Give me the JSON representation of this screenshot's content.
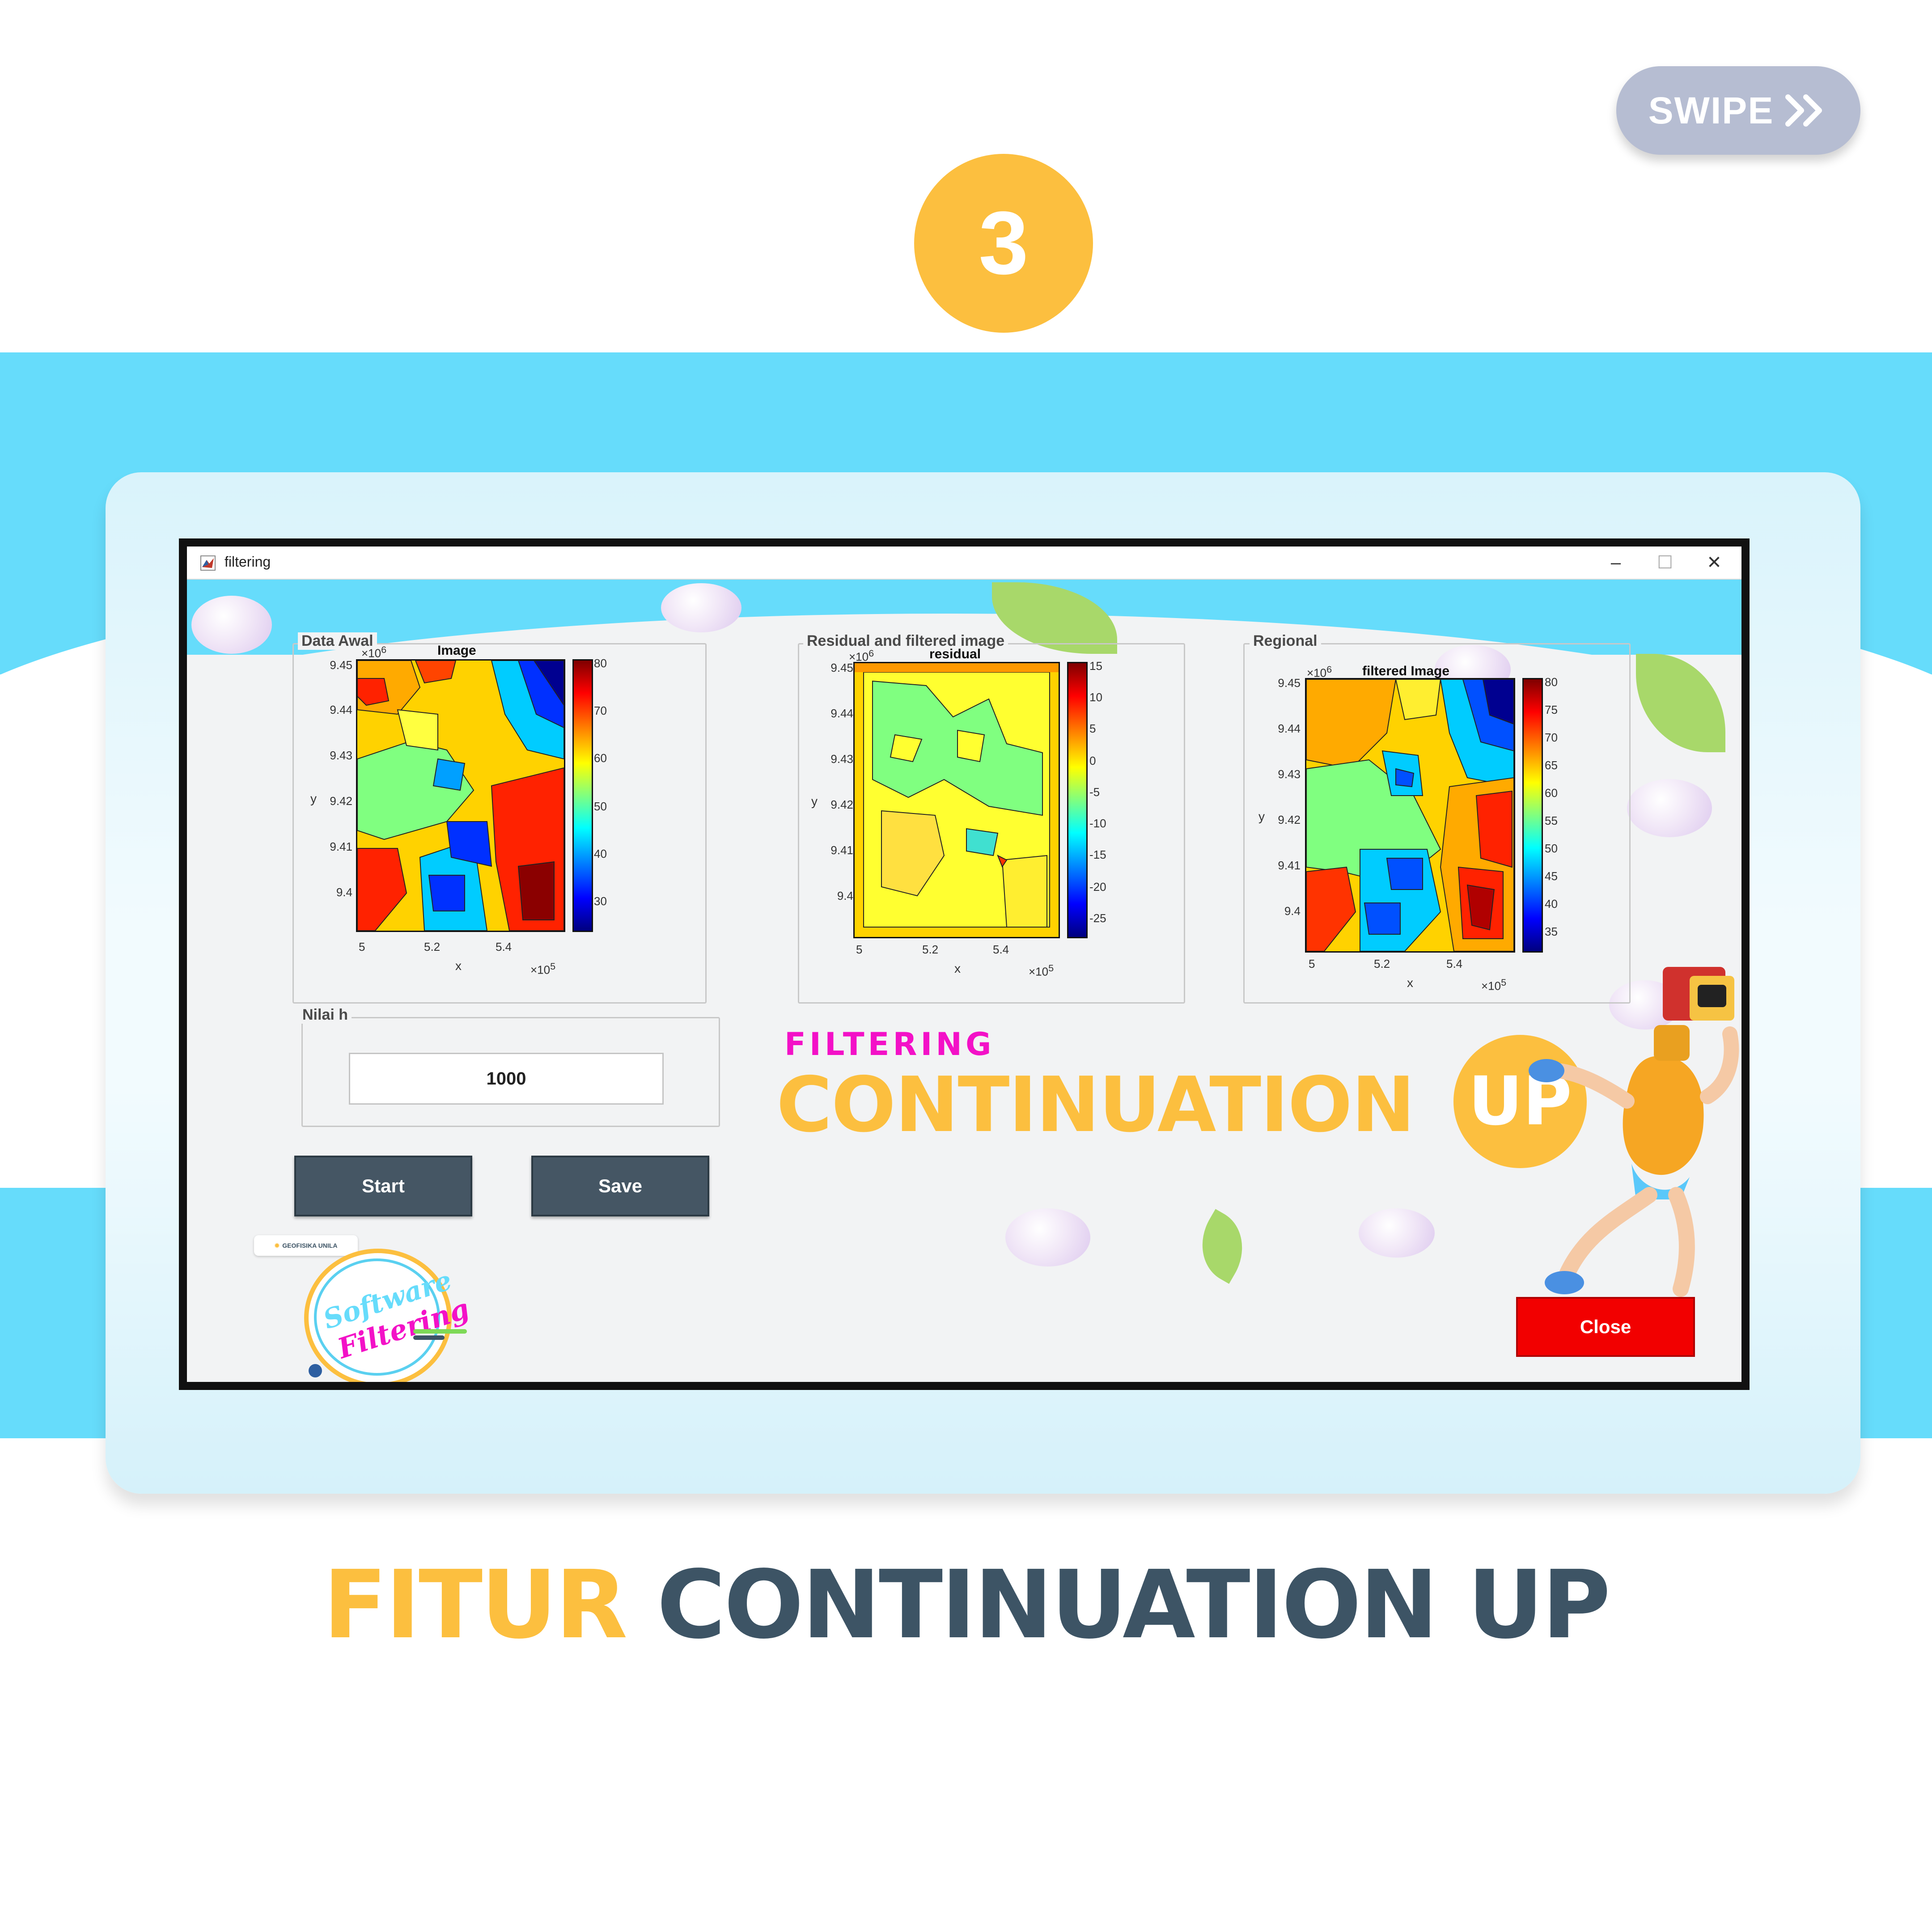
{
  "swipe": {
    "label": "SWIPE"
  },
  "step": {
    "number": "3"
  },
  "window": {
    "title": "filtering",
    "controls": {
      "minimize": "–",
      "maximize": "☐",
      "close": "✕"
    }
  },
  "panels": [
    {
      "title": "Data Awal",
      "plot_title": "Image",
      "y_exponent": "×10",
      "y_exponent_power": "6",
      "y_ticks": [
        "9.45",
        "9.44",
        "9.43",
        "9.42",
        "9.41",
        "9.4"
      ],
      "x_ticks": [
        "5",
        "5.2",
        "5.4"
      ],
      "x_exponent": "×10",
      "x_exponent_power": "5",
      "xlabel": "x",
      "ylabel": "y",
      "colorbar_ticks": [
        "80",
        "70",
        "60",
        "50",
        "40",
        "30"
      ]
    },
    {
      "title": "Residual and filtered image",
      "plot_title": "residual",
      "y_exponent": "×10",
      "y_exponent_power": "6",
      "y_ticks": [
        "9.45",
        "9.44",
        "9.43",
        "9.42",
        "9.41",
        "9.4"
      ],
      "x_ticks": [
        "5",
        "5.2",
        "5.4"
      ],
      "x_exponent": "×10",
      "x_exponent_power": "5",
      "xlabel": "x",
      "ylabel": "y",
      "colorbar_ticks": [
        "15",
        "10",
        "5",
        "0",
        "-5",
        "-10",
        "-15",
        "-20",
        "-25"
      ]
    },
    {
      "title": "Regional",
      "plot_title": "filtered Image",
      "y_exponent": "×10",
      "y_exponent_power": "6",
      "y_ticks": [
        "9.45",
        "9.44",
        "9.43",
        "9.42",
        "9.41",
        "9.4"
      ],
      "x_ticks": [
        "5",
        "5.2",
        "5.4"
      ],
      "x_exponent": "×10",
      "x_exponent_power": "5",
      "xlabel": "x",
      "ylabel": "y",
      "colorbar_ticks": [
        "80",
        "75",
        "70",
        "65",
        "60",
        "55",
        "50",
        "45",
        "40",
        "35"
      ]
    }
  ],
  "nilai_h": {
    "label": "Nilai h",
    "value": "1000"
  },
  "buttons": {
    "start": "Start",
    "save": "Save",
    "close": "Close"
  },
  "branding": {
    "filtering": "FILTERING",
    "continuation": "CONTINUATION",
    "up": "UP",
    "badge_org": "GEOFISIKA UNILA",
    "badge_line1": "Software",
    "badge_line2": "Filtering"
  },
  "footer": {
    "title_accent": "FITUR",
    "title_rest": "CONTINUATION UP"
  },
  "colors": {
    "accent_yellow": "#fcbf3f",
    "sky_blue": "#66dcfb",
    "dark_slate": "#3d5465",
    "button_slate": "#455664",
    "close_red": "#f20000",
    "magenta": "#f311c7",
    "swipe_gray": "#b6bdd2"
  }
}
